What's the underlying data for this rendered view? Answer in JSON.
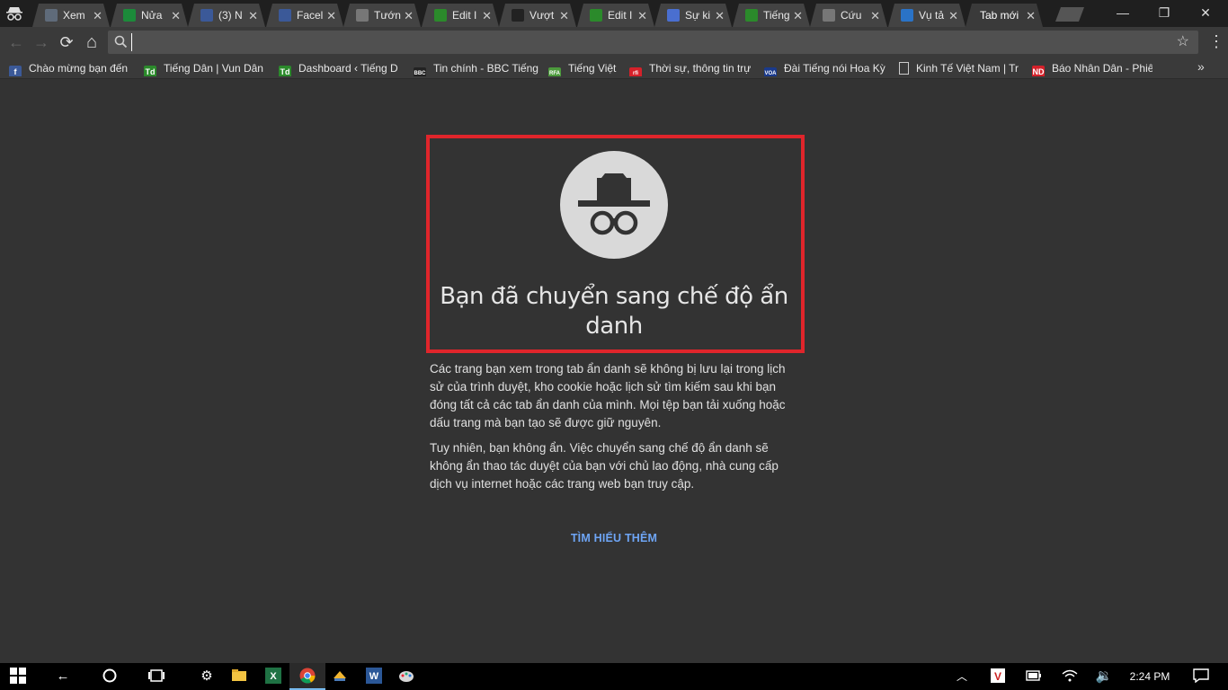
{
  "tabs": [
    {
      "title": "Xem",
      "icon": "globe-icon",
      "color": "#5f6b7a"
    },
    {
      "title": "Nửa",
      "icon": "d-letter-icon",
      "color": "#1c8a3a"
    },
    {
      "title": "(3) N",
      "icon": "facebook-icon",
      "color": "#3b5998"
    },
    {
      "title": "Facel",
      "icon": "facebook-icon",
      "color": "#3b5998"
    },
    {
      "title": "Tướn",
      "icon": "page-icon",
      "color": "#777"
    },
    {
      "title": "Edit I",
      "icon": "td-logo-icon",
      "color": "#2b8a2b"
    },
    {
      "title": "Vượt",
      "icon": "site-icon",
      "color": "#222"
    },
    {
      "title": "Edit I",
      "icon": "td-logo-icon",
      "color": "#2b8a2b"
    },
    {
      "title": "Sự ki",
      "icon": "spiral-icon",
      "color": "#4a6fd0"
    },
    {
      "title": "Tiếng",
      "icon": "td-logo-icon",
      "color": "#2b8a2b"
    },
    {
      "title": "Cứu",
      "icon": "page-icon",
      "color": "#777"
    },
    {
      "title": "Vụ tả",
      "icon": "arrow-logo-icon",
      "color": "#2a73c7"
    },
    {
      "title": "Tab mới",
      "icon": "",
      "color": "",
      "active": true
    }
  ],
  "window": {
    "minimize": "—",
    "restore": "❐",
    "close": "✕"
  },
  "toolbar": {
    "back": "←",
    "forward": "→",
    "reload": "⟳",
    "home": "⌂",
    "search_value": "",
    "star": "☆",
    "menu": "⋮"
  },
  "bookmarks": [
    {
      "label": "Chào mừng bạn đến",
      "icon": "facebook-icon",
      "color": "#3b5998",
      "glyph": "f"
    },
    {
      "label": "Tiếng Dân | Vun Dân",
      "icon": "td-logo-icon",
      "color": "#2b8a2b",
      "glyph": "Td"
    },
    {
      "label": "Dashboard ‹ Tiếng D",
      "icon": "td-logo-icon",
      "color": "#2b8a2b",
      "glyph": "Td"
    },
    {
      "label": "Tin chính - BBC Tiếng",
      "icon": "bbc-icon",
      "color": "#222",
      "glyph": "BBC"
    },
    {
      "label": "Tiếng Việt",
      "icon": "rfa-icon",
      "color": "#4c9a3c",
      "glyph": "RFA"
    },
    {
      "label": "Thời sự, thông tin trự",
      "icon": "rfi-icon",
      "color": "#d5212a",
      "glyph": "rfi"
    },
    {
      "label": "Đài Tiếng nói Hoa Kỳ",
      "icon": "voa-icon",
      "color": "#1a3a8c",
      "glyph": "VOA"
    },
    {
      "label": "Kinh Tế Việt Nam | Tr",
      "icon": "page-icon",
      "color": "#777",
      "glyph": ""
    },
    {
      "label": "Báo Nhân Dân - Phiê",
      "icon": "nd-icon",
      "color": "#d5212a",
      "glyph": "ND"
    }
  ],
  "bookmarks_more": "»",
  "content": {
    "title": "Bạn đã chuyển sang chế độ ẩn danh",
    "para1": "Các trang bạn xem trong tab ẩn danh sẽ không bị lưu lại trong lịch sử của trình duyệt, kho cookie hoặc lịch sử tìm kiếm sau khi bạn đóng tất cả các tab ẩn danh của mình. Mọi tệp bạn tải xuống hoặc dấu trang mà bạn tạo sẽ được giữ nguyên.",
    "para2": "Tuy nhiên, bạn không ẩn. Việc chuyển sang chế độ ẩn danh sẽ không ẩn thao tác duyệt của bạn với chủ lao động, nhà cung cấp dịch vụ internet hoặc các trang web bạn truy cập.",
    "learn_more": "TÌM HIỂU THÊM",
    "highlight_color": "#e0252b",
    "link_color": "#6ea5f5"
  },
  "taskbar": {
    "clock": "2:24 PM",
    "items": [
      "start-icon",
      "back-icon",
      "cortana-icon",
      "task-view-icon",
      "settings-icon",
      "file-explorer-icon",
      "excel-icon",
      "chrome-icon",
      "app-icon",
      "word-icon",
      "paint-icon"
    ]
  }
}
